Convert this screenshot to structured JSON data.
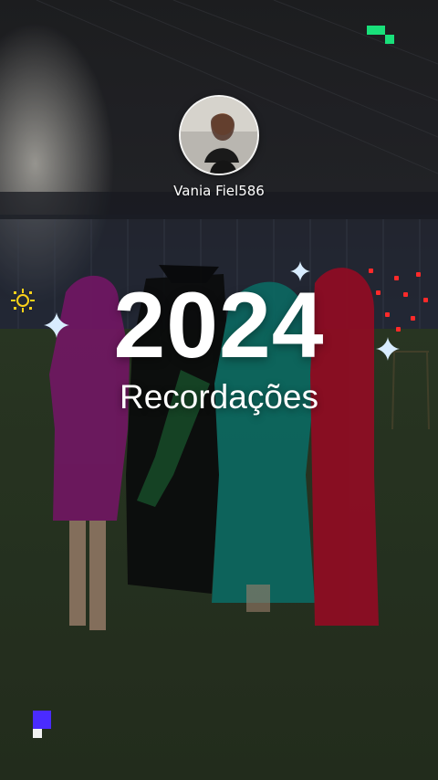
{
  "profile": {
    "username": "Vania Fiel586"
  },
  "story": {
    "year": "2024",
    "subtitle": "Recordações"
  },
  "colors": {
    "accent_green": "#19e07a",
    "accent_purple": "#4a2bff",
    "sparkle_blue": "#d8ecff",
    "sun_yellow": "#ffd21a",
    "dot_red": "#ff2a2a"
  },
  "icons": {
    "top_right": "pixel-steps-icon",
    "bottom_left": "pixel-block-icon",
    "left_sun": "sun-icon",
    "sparkles": "sparkle-icon"
  }
}
